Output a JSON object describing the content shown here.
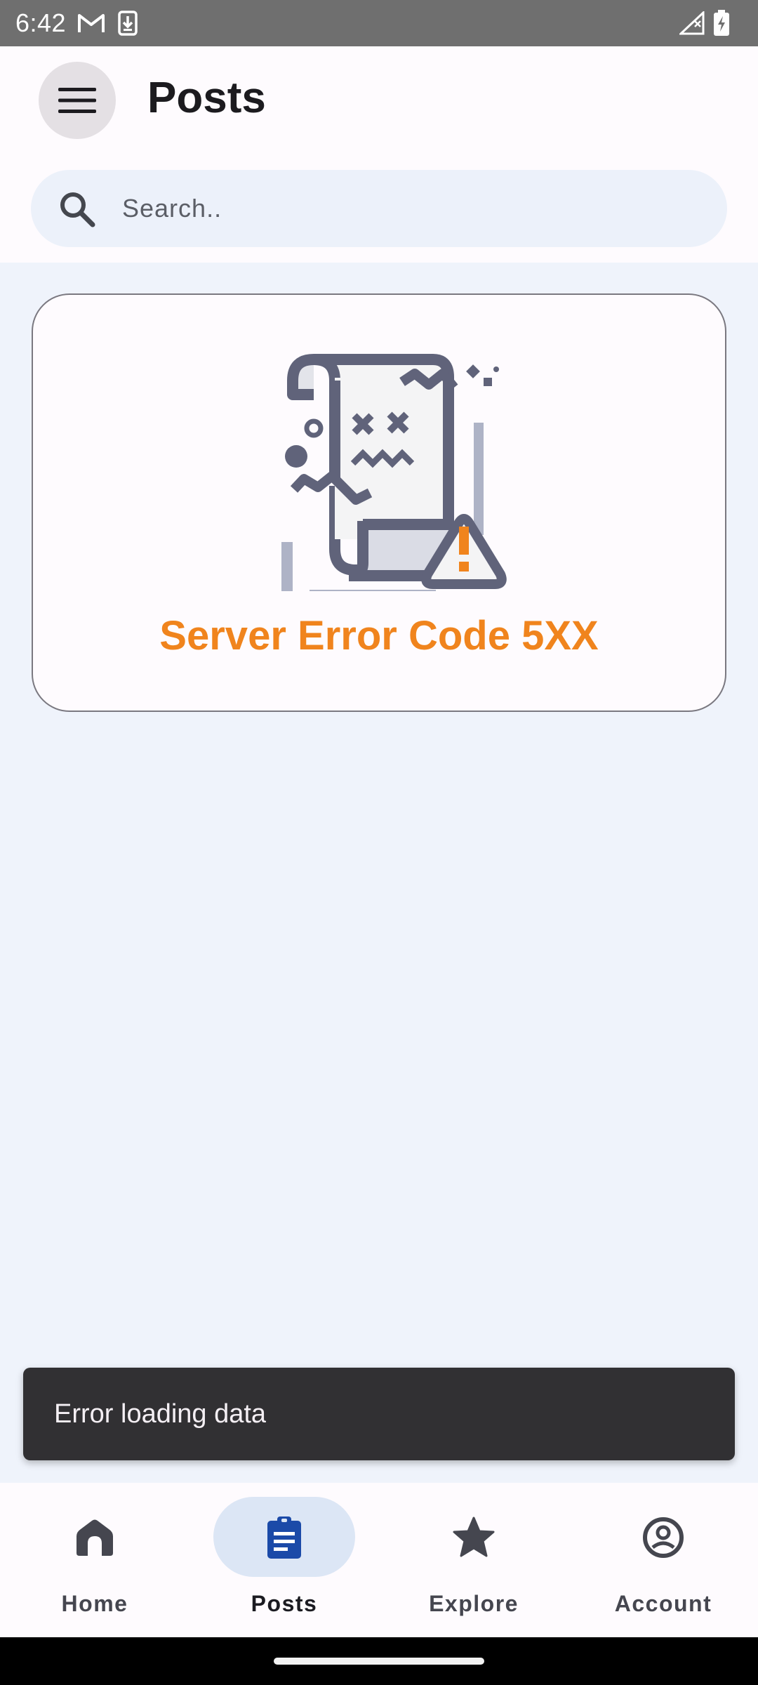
{
  "status_bar": {
    "time": "6:42",
    "icons_left": [
      "gmail-icon",
      "download-notification-icon"
    ],
    "icons_right": [
      "signal-icon",
      "battery-charging-icon"
    ]
  },
  "app_bar": {
    "title": "Posts",
    "menu_icon": "hamburger-menu-icon"
  },
  "search": {
    "placeholder": "Search..",
    "value": ""
  },
  "error_card": {
    "message": "Server Error Code 5XX",
    "message_color": "#f0841d",
    "illustration": "broken-document-warning"
  },
  "snackbar": {
    "text": "Error loading data"
  },
  "bottom_nav": {
    "items": [
      {
        "label": "Home",
        "icon": "home-icon",
        "active": false
      },
      {
        "label": "Posts",
        "icon": "clipboard-icon",
        "active": true
      },
      {
        "label": "Explore",
        "icon": "star-icon",
        "active": false
      },
      {
        "label": "Account",
        "icon": "account-icon",
        "active": false
      }
    ]
  },
  "colors": {
    "accent": "#1b4aa8",
    "background": "#eff3fb",
    "surface": "#fefbfe"
  }
}
